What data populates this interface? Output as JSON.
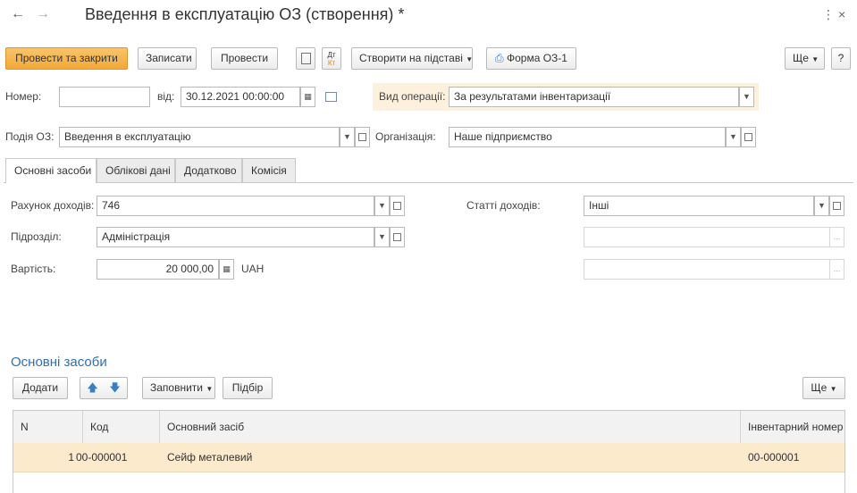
{
  "window": {
    "title": "Введення в експлуатацію ОЗ (створення) *",
    "back_icon": "arrow-left-icon",
    "forward_icon": "arrow-right-icon",
    "more_icon": "kebab-icon",
    "close_icon": "close-icon"
  },
  "toolbar": {
    "post_close": "Провести та закрити",
    "save": "Записати",
    "post": "Провести",
    "create_based": "Створити на підставі",
    "form_label": "Форма ОЗ-1",
    "more": "Ще",
    "help": "?"
  },
  "header": {
    "number_label": "Номер:",
    "number_value": "",
    "date_label": "від:",
    "date_value": "30.12.2021 00:00:00",
    "operation_label": "Вид операції:",
    "operation_value": "За результатами інвентаризації",
    "event_label": "Подія ОЗ:",
    "event_value": "Введення в експлуатацію",
    "org_label": "Організація:",
    "org_value": "Наше підприємство"
  },
  "tabs": [
    {
      "label": "Основні засоби"
    },
    {
      "label": "Облікові дані"
    },
    {
      "label": "Додатково"
    },
    {
      "label": "Комісія"
    }
  ],
  "main": {
    "income_account_label": "Рахунок доходів:",
    "income_account_value": "746",
    "income_items_label": "Статті доходів:",
    "income_items_value": "Інші",
    "department_label": "Підрозділ:",
    "department_value": "Адміністрація",
    "cost_label": "Вартість:",
    "cost_value": "20 000,00",
    "currency": "UAH",
    "extra_field_1": "",
    "extra_field_2": ""
  },
  "assets": {
    "title": "Основні засоби",
    "add": "Додати",
    "fill": "Заповнити",
    "select": "Підбір",
    "more": "Ще",
    "columns": [
      "N",
      "Код",
      "Основний засіб",
      "Інвентарний номер"
    ],
    "rows": [
      {
        "n": "1",
        "code": "00-000001",
        "name": "Сейф металевий",
        "inv": "00-000001"
      }
    ]
  },
  "colors": {
    "accent": "#f2a937",
    "link": "#2f6fb3",
    "selected_row": "#fbeacc",
    "highlight_field": "#fdf0dd"
  }
}
